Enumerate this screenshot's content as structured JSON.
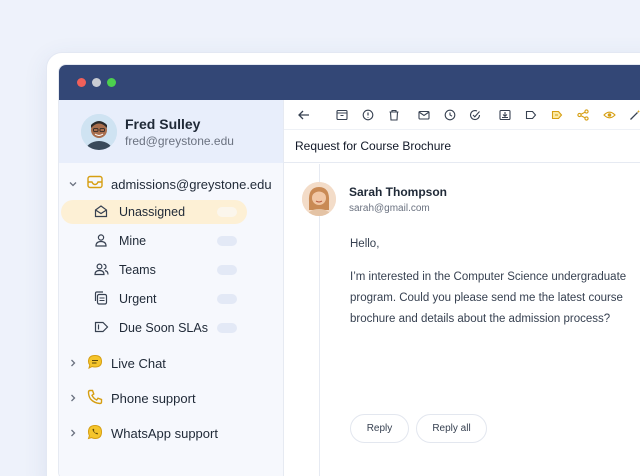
{
  "profile": {
    "name": "Fred Sulley",
    "email": "fred@greystone.edu"
  },
  "inbox": {
    "address": "admissions@greystone.edu",
    "items": [
      {
        "label": "Unassigned",
        "icon": "envelope-open-icon"
      },
      {
        "label": "Mine",
        "icon": "user-icon"
      },
      {
        "label": "Teams",
        "icon": "users-icon"
      },
      {
        "label": "Urgent",
        "icon": "copy-icon"
      },
      {
        "label": "Due Soon SLAs",
        "icon": "tag-icon"
      }
    ]
  },
  "groups": [
    {
      "label": "Live Chat",
      "icon": "chat-bubble-icon"
    },
    {
      "label": "Phone support",
      "icon": "phone-icon"
    },
    {
      "label": "WhatsApp support",
      "icon": "whatsapp-icon"
    }
  ],
  "message": {
    "subject": "Request for Course Brochure",
    "sender_name": "Sarah Thompson",
    "sender_email": "sarah@gmail.com",
    "greeting": "Hello,",
    "body": "I’m interested in the Computer Science undergraduate program. Could you please send me the latest course brochure and details about the admission process?"
  },
  "actions": {
    "reply": "Reply",
    "reply_all": "Reply all"
  },
  "colors": {
    "titlebar": "#334776",
    "active_item": "#fdf0d5",
    "accent_yellow": "#f5c52b"
  }
}
